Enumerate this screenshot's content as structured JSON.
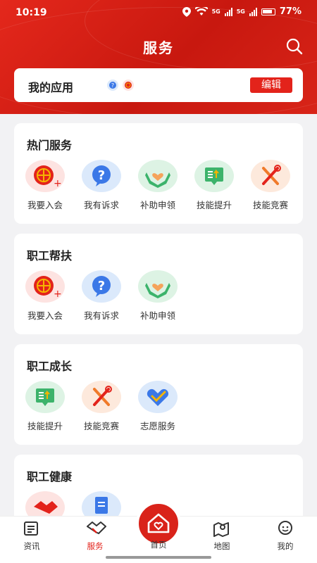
{
  "status_bar": {
    "time": "10:19",
    "battery": "77%",
    "signal1": "5G",
    "signal2": "5G"
  },
  "header": {
    "title": "服务"
  },
  "my_apps": {
    "title": "我的应用",
    "edit_label": "编辑"
  },
  "sections": [
    {
      "title": "热门服务",
      "items": [
        {
          "label": "我要入会",
          "icon": "union-emblem-icon"
        },
        {
          "label": "我有诉求",
          "icon": "question-bubble-icon"
        },
        {
          "label": "补助申领",
          "icon": "hands-heart-icon"
        },
        {
          "label": "技能提升",
          "icon": "skill-board-icon"
        },
        {
          "label": "技能竞赛",
          "icon": "tools-icon"
        }
      ]
    },
    {
      "title": "职工帮扶",
      "items": [
        {
          "label": "我要入会",
          "icon": "union-emblem-icon"
        },
        {
          "label": "我有诉求",
          "icon": "question-bubble-icon"
        },
        {
          "label": "补助申领",
          "icon": "hands-heart-icon"
        }
      ]
    },
    {
      "title": "职工成长",
      "items": [
        {
          "label": "技能提升",
          "icon": "skill-board-icon"
        },
        {
          "label": "技能竞赛",
          "icon": "tools-icon"
        },
        {
          "label": "志愿服务",
          "icon": "volunteer-heart-icon"
        }
      ]
    },
    {
      "title": "职工健康",
      "items": []
    }
  ],
  "tabbar": {
    "items": [
      {
        "label": "资讯",
        "icon": "news-icon",
        "active": false
      },
      {
        "label": "服务",
        "icon": "handshake-icon",
        "active": true
      },
      {
        "label": "首页",
        "icon": "home-icon",
        "active": false
      },
      {
        "label": "地图",
        "icon": "map-icon",
        "active": false
      },
      {
        "label": "我的",
        "icon": "profile-icon",
        "active": false
      }
    ]
  },
  "colors": {
    "brand_red": "#e3231b",
    "background": "#f2f2f4"
  }
}
